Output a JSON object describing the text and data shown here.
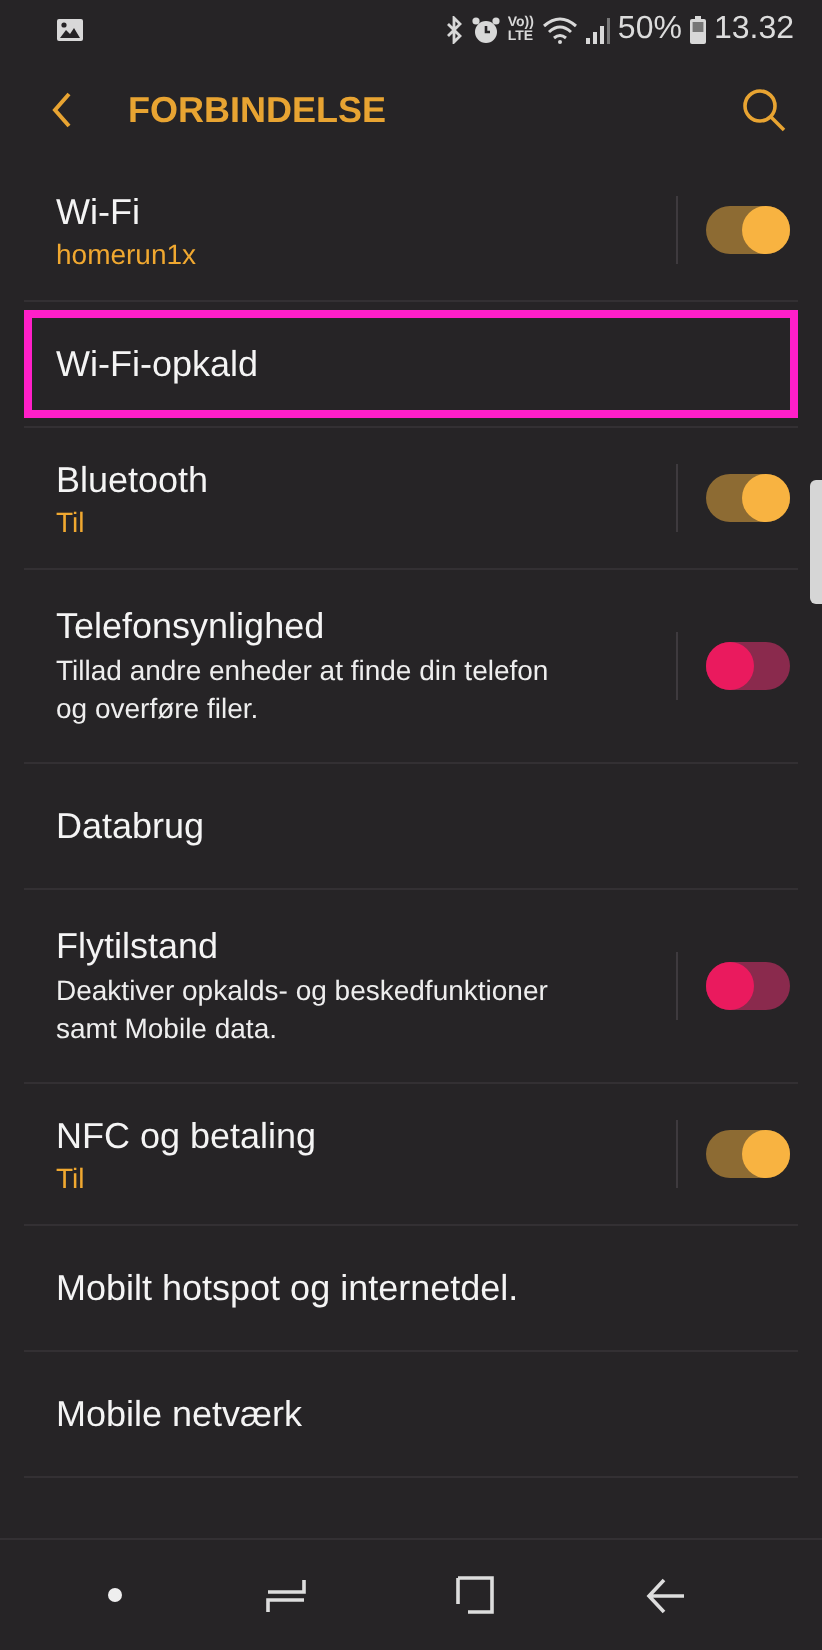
{
  "status_bar": {
    "network_label": [
      "Vo))",
      "LTE"
    ],
    "battery": "50%",
    "time": "13.32"
  },
  "header": {
    "title": "FORBINDELSE"
  },
  "items": [
    {
      "title": "Wi-Fi",
      "subtitle": {
        "kind": "value",
        "text": "homerun1x"
      },
      "toggle": {
        "on": true
      },
      "highlighted": false
    },
    {
      "title": "Wi-Fi-opkald",
      "highlighted": true
    },
    {
      "title": "Bluetooth",
      "subtitle": {
        "kind": "value",
        "text": "Til"
      },
      "toggle": {
        "on": true
      },
      "highlighted": false
    },
    {
      "title": "Telefonsynlighed",
      "subtitle": {
        "kind": "description",
        "text": "Tillad andre enheder at finde din telefon og overføre filer."
      },
      "toggle": {
        "on": false
      },
      "highlighted": false
    },
    {
      "title": "Databrug",
      "highlighted": false
    },
    {
      "title": "Flytilstand",
      "subtitle": {
        "kind": "description",
        "text": "Deaktiver opkalds- og beskedfunktioner samt Mobile data."
      },
      "toggle": {
        "on": false
      },
      "highlighted": false
    },
    {
      "title": "NFC og betaling",
      "subtitle": {
        "kind": "value",
        "text": "Til"
      },
      "toggle": {
        "on": true
      },
      "highlighted": false
    },
    {
      "title": "Mobilt hotspot og internetdel.",
      "highlighted": false
    },
    {
      "title": "Mobile netværk",
      "highlighted": false
    }
  ]
}
